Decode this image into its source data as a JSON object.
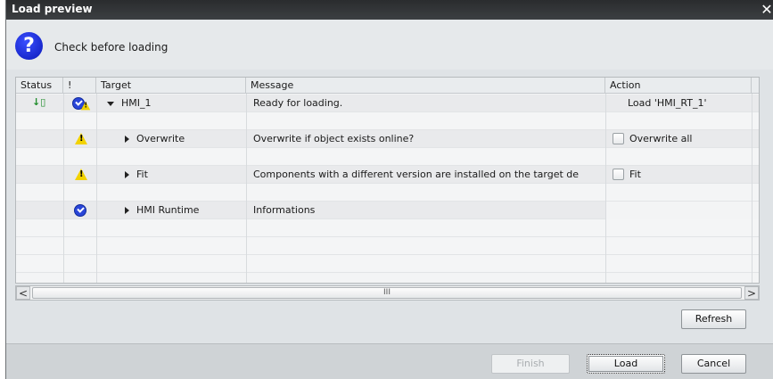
{
  "dialog": {
    "title": "Load preview",
    "close_glyph": "✕",
    "header_text": "Check before loading",
    "header_icon": "question-icon"
  },
  "columns": [
    "Status",
    "!",
    "Target",
    "Message",
    "Action"
  ],
  "rows": [
    {
      "target": "HMI_1",
      "expanded": true,
      "message": "Ready for loading.",
      "action": "Load 'HMI_RT_1'",
      "status_icon": "download-arrow-icon",
      "flag_icon": "ok-warning-icon"
    },
    {
      "target": "Overwrite",
      "expanded": false,
      "message": "Overwrite if object exists online?",
      "action": "Overwrite all",
      "flag_icon": "warning-icon",
      "action_checkbox": true
    },
    {
      "target": "Fit",
      "expanded": false,
      "message": "Components with a different version are installed on the target de",
      "action": "Fit",
      "flag_icon": "warning-icon",
      "action_checkbox": true
    },
    {
      "target": "HMI Runtime",
      "expanded": false,
      "message": "Informations",
      "action": "",
      "flag_icon": "ok-icon"
    }
  ],
  "scroll": {
    "left": "<",
    "right": ">",
    "thumb_grip": "III"
  },
  "buttons": {
    "refresh": "Refresh",
    "finish": "Finish",
    "load": "Load",
    "cancel": "Cancel"
  },
  "colors": {
    "titlebar": "#2a2c2e",
    "warning": "#f2d200",
    "ok": "#2a46d8",
    "status_green": "#1e8c2a"
  }
}
